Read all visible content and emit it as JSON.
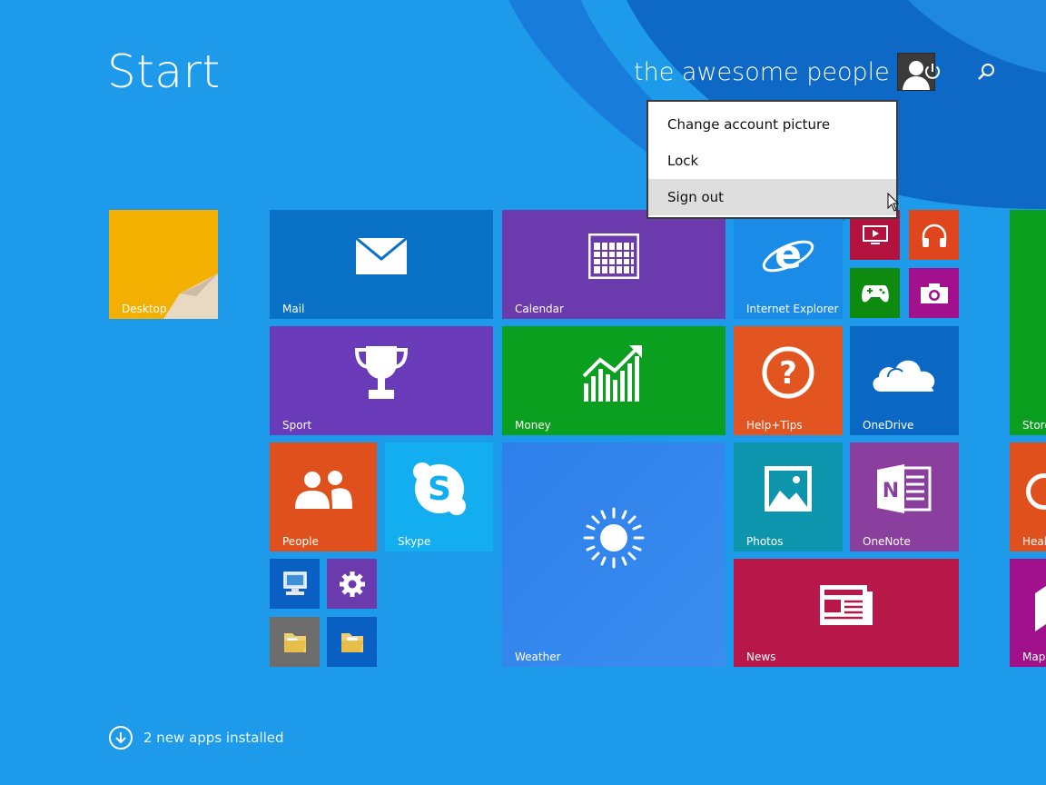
{
  "header": {
    "title": "Start",
    "username": "the awesome people"
  },
  "account_menu": {
    "items": [
      {
        "label": "Change account picture"
      },
      {
        "label": "Lock"
      },
      {
        "label": "Sign out",
        "hovered": true
      }
    ]
  },
  "tiles": {
    "desktop": {
      "label": "Desktop",
      "color": "#f2b300"
    },
    "mail": {
      "label": "Mail",
      "color": "#0a72c6"
    },
    "calendar": {
      "label": "Calendar",
      "color": "#6b3aad"
    },
    "internet_explorer": {
      "label": "Internet Explorer",
      "color": "#1a8ce8"
    },
    "video": {
      "label": "",
      "color": "#b3123f"
    },
    "music": {
      "label": "",
      "color": "#e0461e"
    },
    "games": {
      "label": "",
      "color": "#0e8a0e"
    },
    "camera": {
      "label": "",
      "color": "#a2108e"
    },
    "sport": {
      "label": "Sport",
      "color": "#6a3bb8"
    },
    "money": {
      "label": "Money",
      "color": "#0a9f1f"
    },
    "help_tips": {
      "label": "Help+Tips",
      "color": "#e35520"
    },
    "onedrive": {
      "label": "OneDrive",
      "color": "#0a68c4"
    },
    "store": {
      "label": "Store",
      "color": "#0a9f1f"
    },
    "people": {
      "label": "People",
      "color": "#e0501c"
    },
    "skype": {
      "label": "Skype",
      "color": "#12aef0"
    },
    "weather": {
      "label": "Weather",
      "color": "#2f86ec"
    },
    "photos": {
      "label": "Photos",
      "color": "#0d95ad"
    },
    "onenote": {
      "label": "OneNote",
      "color": "#8a3f9e"
    },
    "health": {
      "label": "Heal",
      "color": "#e0501c"
    },
    "this_pc": {
      "label": "",
      "color": "#0a5fc2"
    },
    "settings": {
      "label": "",
      "color": "#6b3aad"
    },
    "file_explorer": {
      "label": "",
      "color": "#6d6d6d"
    },
    "libraries": {
      "label": "",
      "color": "#0a5fc2"
    },
    "news": {
      "label": "News",
      "color": "#b8174a"
    },
    "maps": {
      "label": "Maps",
      "color": "#a0108a"
    }
  },
  "footer": {
    "text": "2 new apps installed"
  }
}
